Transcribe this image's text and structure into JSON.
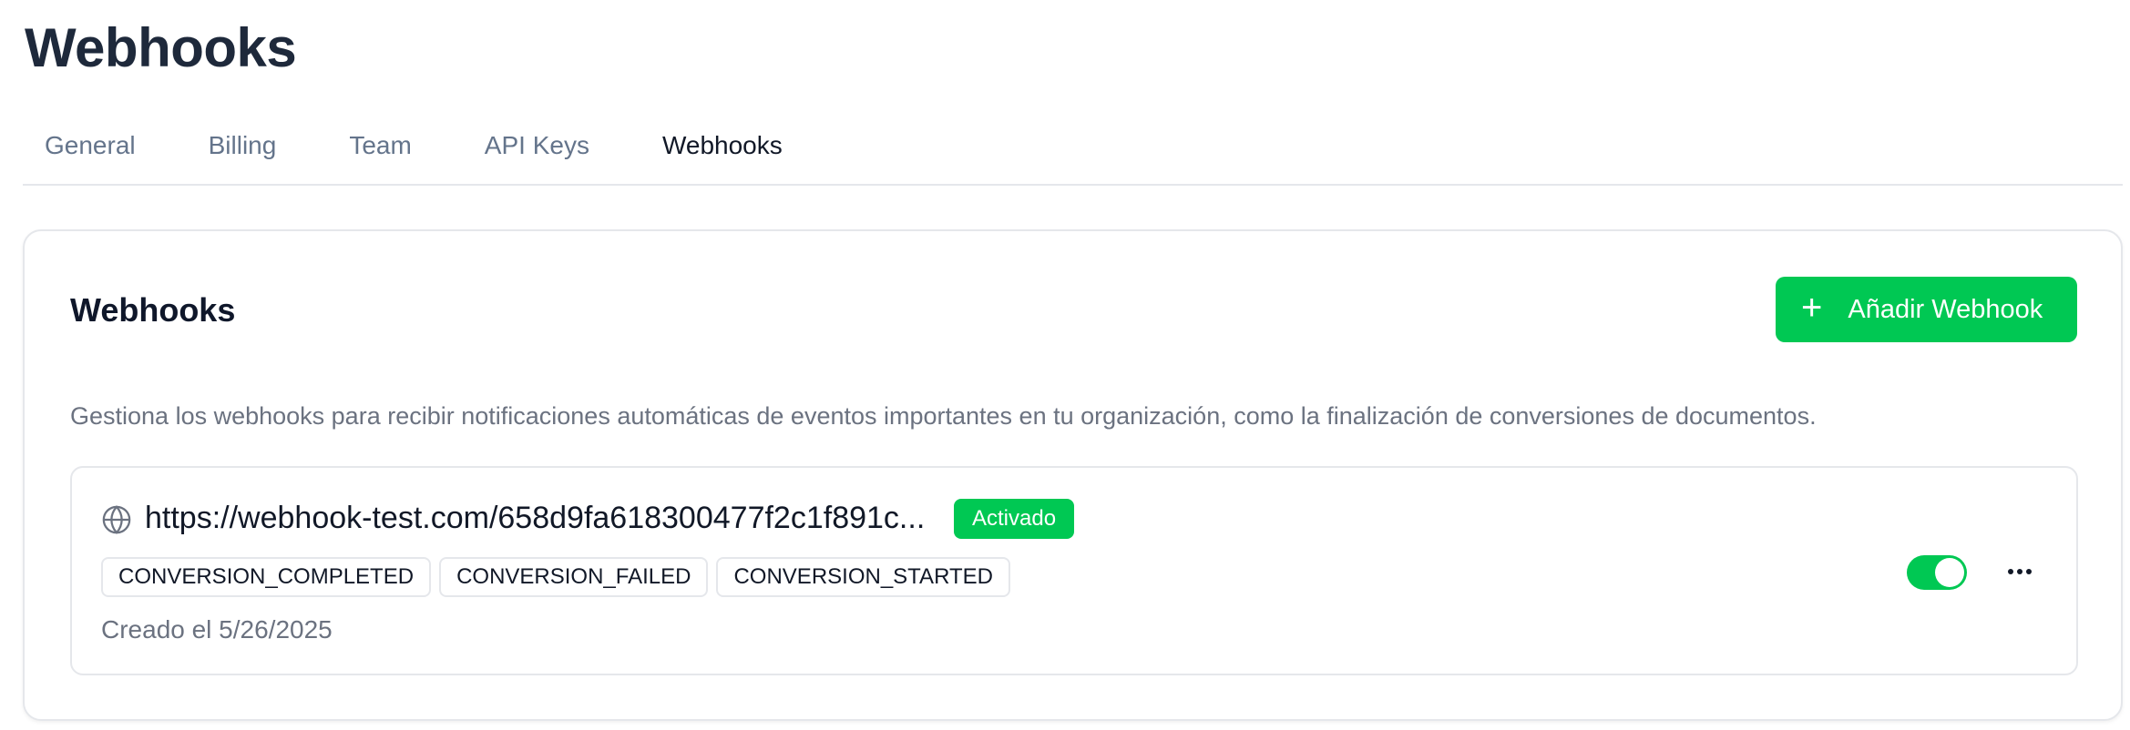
{
  "page": {
    "title": "Webhooks"
  },
  "tabs": [
    {
      "label": "General",
      "active": false
    },
    {
      "label": "Billing",
      "active": false
    },
    {
      "label": "Team",
      "active": false
    },
    {
      "label": "API Keys",
      "active": false
    },
    {
      "label": "Webhooks",
      "active": true
    }
  ],
  "card": {
    "title": "Webhooks",
    "add_button_label": "Añadir Webhook",
    "add_button_icon": "plus-icon",
    "description": "Gestiona los webhooks para recibir notificaciones automáticas de eventos importantes en tu organización, como la finalización de conversiones de documentos."
  },
  "webhooks": [
    {
      "icon": "globe-icon",
      "url": "https://webhook-test.com/658d9fa618300477f2c1f891c...",
      "status": "Activado",
      "events": [
        "CONVERSION_COMPLETED",
        "CONVERSION_FAILED",
        "CONVERSION_STARTED"
      ],
      "created": "Creado el 5/26/2025",
      "enabled": true,
      "menu_icon": "more-horizontal-icon"
    }
  ],
  "colors": {
    "accent": "#00c853",
    "title": "#1e293b",
    "muted": "#6b7280",
    "border": "#e5e7eb"
  }
}
